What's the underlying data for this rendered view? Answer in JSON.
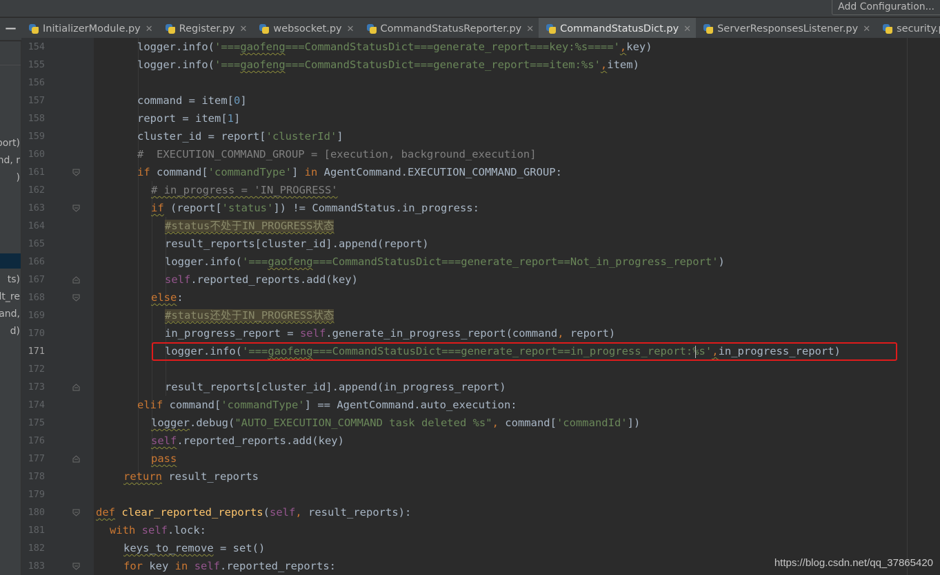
{
  "toolbar": {
    "add_configuration": "Add Configuration..."
  },
  "tabs": [
    {
      "label": "InitializerModule.py",
      "active": false
    },
    {
      "label": "Register.py",
      "active": false
    },
    {
      "label": "websocket.py",
      "active": false
    },
    {
      "label": "CommandStatusReporter.py",
      "active": false
    },
    {
      "label": "CommandStatusDict.py",
      "active": true
    },
    {
      "label": "ServerResponsesListener.py",
      "active": false
    },
    {
      "label": "security.py",
      "active": false
    }
  ],
  "project_panel_fragments": [
    "port)",
    "nd, r",
    ")",
    "ts)",
    "lt_re",
    "and,",
    "d)"
  ],
  "editor": {
    "current_line": 171,
    "line_numbers": [
      "154",
      "155",
      "156",
      "157",
      "158",
      "159",
      "160",
      "161",
      "162",
      "163",
      "164",
      "165",
      "166",
      "167",
      "168",
      "169",
      "170",
      "171",
      "172",
      "173",
      "174",
      "175",
      "176",
      "177",
      "178",
      "179",
      "180",
      "181",
      "182",
      "183"
    ]
  },
  "code": {
    "l154": [
      "logger",
      ".info(",
      "'===",
      "gaofeng",
      "===CommandStatusDict===generate_report===key:%s===='",
      ",",
      "key)"
    ],
    "l155": [
      "logger",
      ".info(",
      "'===",
      "gaofeng",
      "===CommandStatusDict===generate_report===item:%s'",
      ",",
      "item)"
    ],
    "l157": [
      "command = item[",
      "0",
      "]"
    ],
    "l158": [
      "report = item[",
      "1",
      "]"
    ],
    "l159": [
      "cluster_id = report[",
      "'clusterId'",
      "]"
    ],
    "l160": [
      "#  EXECUTION_COMMAND_GROUP = [execution, background_execution]"
    ],
    "l161": [
      "if",
      " command[",
      "'commandType'",
      "] ",
      "in",
      " AgentCommand.EXECUTION_COMMAND_GROUP:"
    ],
    "l162": [
      "# in_progress = 'IN_PROGRESS'"
    ],
    "l163": [
      "if",
      " (report[",
      "'status'",
      "]) != CommandStatus.in_progress:"
    ],
    "l164": [
      "#status不处于IN_PROGRESS状态"
    ],
    "l165": [
      "result_reports[cluster_id].append(report)"
    ],
    "l166": [
      "logger.info(",
      "'===",
      "gaofeng",
      "===CommandStatusDict===generate_report==Not_in_progress_report'",
      ")"
    ],
    "l167": [
      "self",
      ".reported_reports.add(key)"
    ],
    "l168": [
      "else",
      ":"
    ],
    "l169": [
      "#status还处于IN_PROGRESS状态"
    ],
    "l170": [
      "in_progress_report = ",
      "self",
      ".generate_in_progress_report(command",
      ",",
      " report)"
    ],
    "l171": [
      "logger.info(",
      "'===",
      "gaofeng",
      "===CommandStatusDict===generate_report==in_progress_report:%s'",
      ",",
      "in_progress_report)"
    ],
    "l173": [
      "result_reports[cluster_id].append(in_progress_report)"
    ],
    "l174": [
      "elif",
      " command[",
      "'commandType'",
      "] == AgentCommand.auto_execution:"
    ],
    "l175": [
      "logger",
      ".debug(",
      "\"AUTO_EXECUTION_COMMAND task deleted %s\"",
      ",",
      " command[",
      "'commandId'",
      "])"
    ],
    "l176": [
      "self",
      ".reported_reports.add(key)"
    ],
    "l177": [
      "pass"
    ],
    "l178": [
      "return",
      " result_reports"
    ],
    "l180": [
      "def",
      " ",
      "clear_reported_reports",
      "(",
      "self",
      ",",
      " result_reports):"
    ],
    "l181": [
      "with",
      " ",
      "self",
      ".lock:"
    ],
    "l182": [
      "keys_to_remove",
      " = ",
      "set",
      "()"
    ],
    "l183": [
      "for",
      " key ",
      "in",
      " ",
      "self",
      ".reported_reports:"
    ]
  },
  "watermark": "https://blog.csdn.net/qq_37865420",
  "colors": {
    "background": "#2b2b2b",
    "keyword": "#cc7832",
    "string": "#6a8759",
    "number": "#6897bb",
    "comment": "#808080",
    "self": "#94558d",
    "function": "#ffc66d",
    "default_text": "#a9b7c6",
    "highlight_box": "#e11b1b",
    "active_tab_underline": "#4a88c7"
  }
}
